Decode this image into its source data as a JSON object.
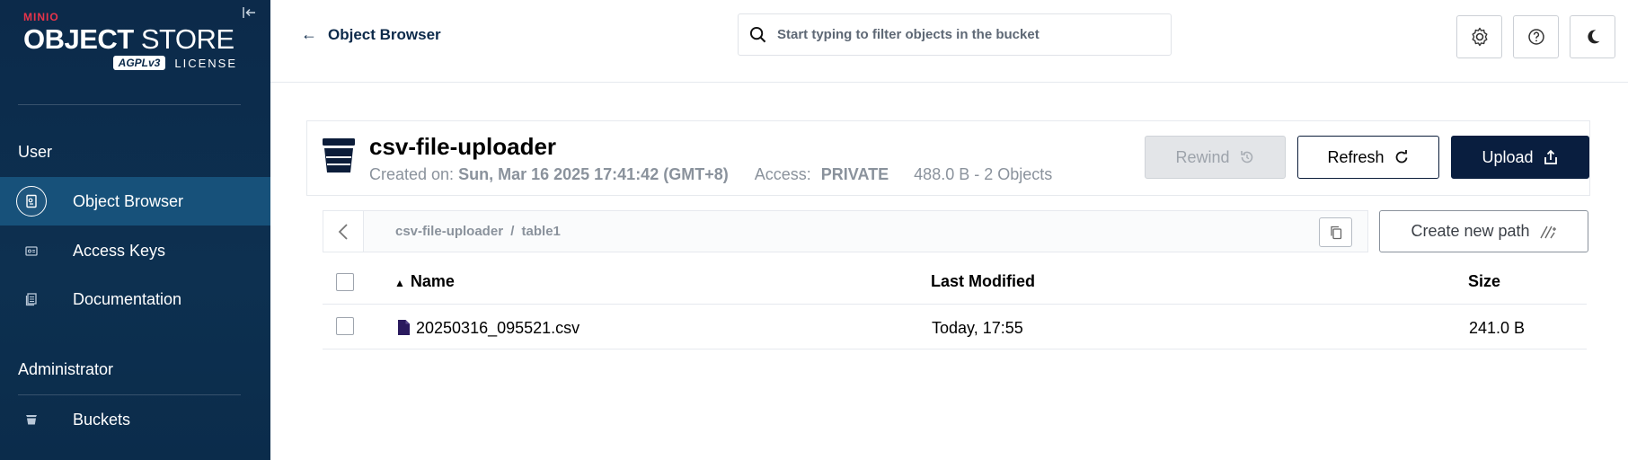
{
  "brand": {
    "minio": "MINIO",
    "title_bold": "OBJECT",
    "title_light": "STORE",
    "agpl": "AGPLv3",
    "license": "LICENSE"
  },
  "sidebar": {
    "sections": [
      {
        "label": "User"
      },
      {
        "label": "Administrator"
      }
    ],
    "items": [
      {
        "label": "Object Browser",
        "icon": "object-browser-icon",
        "active": true
      },
      {
        "label": "Access Keys",
        "icon": "access-keys-icon"
      },
      {
        "label": "Documentation",
        "icon": "documentation-icon"
      },
      {
        "label": "Buckets",
        "icon": "buckets-icon"
      }
    ]
  },
  "header": {
    "back_label": "Object Browser",
    "search_placeholder": "Start typing to filter objects in the bucket"
  },
  "bucket": {
    "name": "csv-file-uploader",
    "created_label": "Created on:",
    "created_value": "Sun, Mar 16 2025 17:41:42 (GMT+8)",
    "access_label": "Access:",
    "access_value": "PRIVATE",
    "summary": "488.0 B - 2 Objects",
    "rewind_label": "Rewind",
    "refresh_label": "Refresh",
    "upload_label": "Upload"
  },
  "path": {
    "bucket": "csv-file-uploader",
    "separator": "/",
    "folder": "table1",
    "create_new_path_label": "Create new path"
  },
  "table": {
    "columns": {
      "name": "Name",
      "last_modified": "Last Modified",
      "size": "Size"
    },
    "rows": [
      {
        "name": "20250316_095521.csv",
        "last_modified": "Today, 17:55",
        "size": "241.0 B"
      }
    ]
  },
  "colors": {
    "sidebar_bg": "#0c2a4a",
    "sidebar_active": "#17517a",
    "primary_button": "#091e3f",
    "brand_red": "#e8344a"
  }
}
